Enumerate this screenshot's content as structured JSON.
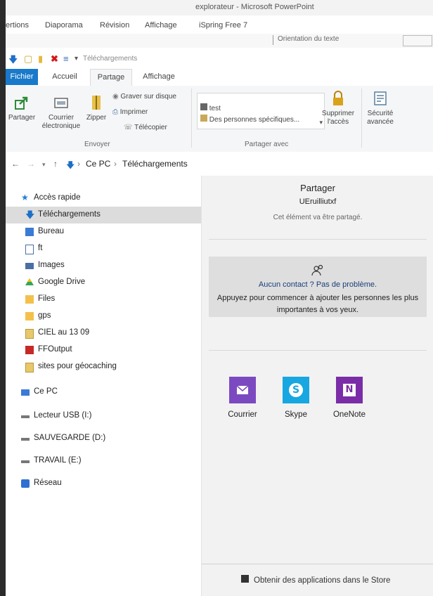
{
  "powerpoint": {
    "title": "explorateur - Microsoft PowerPoint",
    "tabs": [
      "ertions",
      "Diaporama",
      "Révision",
      "Affichage",
      "iSpring Free 7"
    ],
    "textbox_label": "Orientation du texte"
  },
  "qat": {
    "title": "Téléchargements"
  },
  "ribbon_tabs": {
    "file": "Fichier",
    "home": "Accueil",
    "share": "Partage",
    "view": "Affichage"
  },
  "ribbon": {
    "share_btn": "Partager",
    "email_btn": "Courrier électronique",
    "zip_btn": "Zipper",
    "burn_btn": "Graver sur disque",
    "print_btn": "Imprimer",
    "fax_btn": "Télécopier",
    "send_group": "Envoyer",
    "share_list": [
      "test",
      "Des personnes spécifiques..."
    ],
    "remove_btn": "Supprimer l'accès",
    "security_btn": "Sécurité avancée",
    "share_with_group": "Partager avec"
  },
  "address": {
    "root": "Ce PC",
    "folder": "Téléchargements"
  },
  "nav": {
    "quick_access": "Accès rapide",
    "items": [
      "Téléchargements",
      "Bureau",
      "ft",
      "Images",
      "Google Drive",
      "Files",
      "gps",
      "CIEL au 13 09",
      "FFOutput",
      "sites pour géocaching"
    ],
    "this_pc": "Ce PC",
    "drives": [
      "Lecteur USB (I:)",
      "SAUVEGARDE (D:)",
      "TRAVAIL (E:)"
    ],
    "network": "Réseau"
  },
  "share_panel": {
    "title": "Partager",
    "item_name": "UEruilliutxf",
    "subtitle": "Cet élément va être partagé.",
    "no_contact_title": "Aucun contact ? Pas de problème.",
    "no_contact_text": "Appuyez pour commencer à ajouter les personnes les plus importantes à vos yeux.",
    "apps": [
      {
        "label": "Courrier",
        "color": "#7c4ac0",
        "icon": "mail-icon"
      },
      {
        "label": "Skype",
        "color": "#18a7e0",
        "icon": "skype-icon"
      },
      {
        "label": "OneNote",
        "color": "#7b2da8",
        "icon": "onenote-icon"
      }
    ],
    "store_link": "Obtenir des applications dans le Store"
  }
}
